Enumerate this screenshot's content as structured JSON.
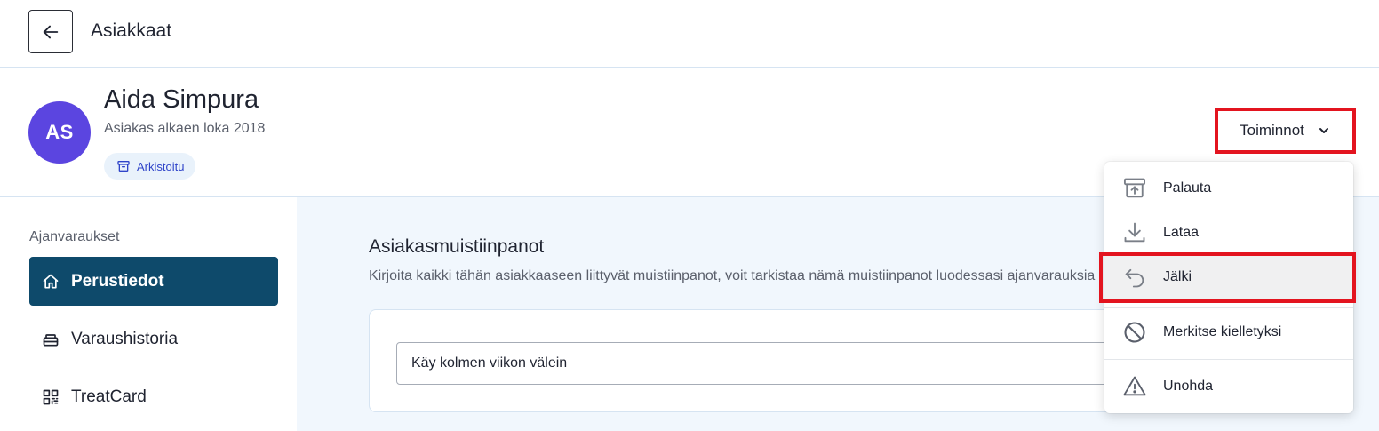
{
  "header": {
    "title": "Asiakkaat",
    "back_icon": "arrow-left-icon"
  },
  "profile": {
    "initials": "AS",
    "name": "Aida Simpura",
    "since": "Asiakas alkaen loka 2018",
    "badge": "Arkistoitu",
    "avatar_color": "#5b45e0"
  },
  "actions": {
    "label": "Toiminnot",
    "items": [
      {
        "label": "Palauta",
        "icon": "unarchive-icon"
      },
      {
        "label": "Lataa",
        "icon": "download-icon"
      },
      {
        "label": "Jälki",
        "icon": "undo-icon"
      },
      {
        "label": "Merkitse kielletyksi",
        "icon": "ban-icon"
      },
      {
        "label": "Unohda",
        "icon": "warning-icon"
      }
    ]
  },
  "sidebar": {
    "heading": "Ajanvaraukset",
    "items": [
      {
        "label": "Perustiedot",
        "icon": "home-icon",
        "active": true
      },
      {
        "label": "Varaushistoria",
        "icon": "history-icon",
        "active": false
      },
      {
        "label": "TreatCard",
        "icon": "qr-code-icon",
        "active": false
      }
    ]
  },
  "notes": {
    "title": "Asiakasmuistiinpanot",
    "description": "Kirjoita kaikki tähän asiakkaaseen liittyvät muistiinpanot, voit tarkistaa nämä muistiinpanot luodessasi ajanvarauksia",
    "value": "Käy kolmen viikon välein"
  },
  "colors": {
    "primary_nav": "#0e4a6b",
    "highlight": "#e3141f",
    "badge_text": "#2f44c9"
  }
}
